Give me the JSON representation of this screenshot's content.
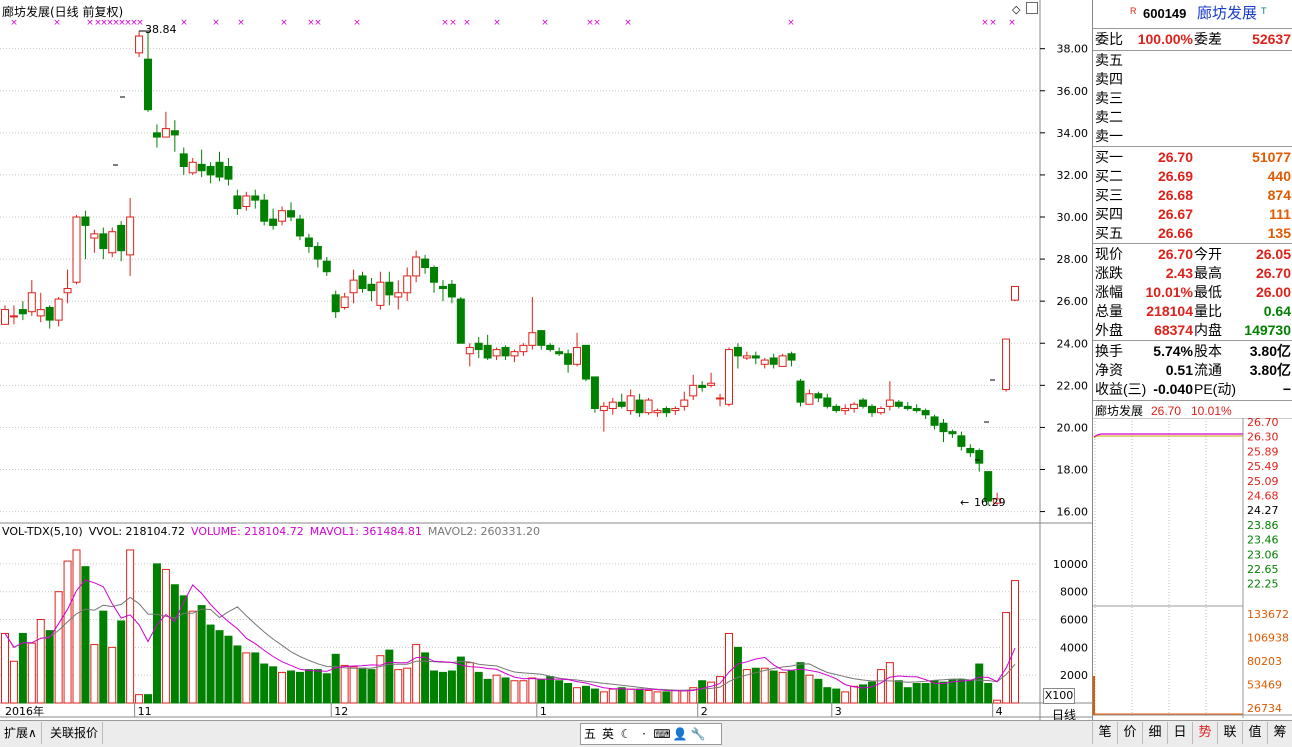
{
  "chart_title": "廊坊发展(日线 前复权)",
  "price_axis": {
    "ticks": [
      "38.00",
      "36.00",
      "34.00",
      "32.00",
      "30.00",
      "28.00",
      "26.00",
      "24.00",
      "22.00",
      "20.00",
      "18.00",
      "16.00"
    ],
    "ylim": [
      15.6,
      39.6
    ]
  },
  "annotations": {
    "high": "38.84",
    "low": "16.29"
  },
  "volume_legend": {
    "indicator": "VOL-TDX(5,10)",
    "vvol": "VVOL: 218104.72",
    "volume": "VOLUME: 218104.72",
    "mavol1": "MAVOL1: 361484.81",
    "mavol2": "MAVOL2: 260331.20"
  },
  "volume_axis": {
    "ticks": [
      "10000",
      "8000",
      "6000",
      "4000",
      "2000"
    ],
    "unit": "X100"
  },
  "x_axis": {
    "labels": [
      "2016年",
      "11",
      "12",
      "1",
      "2",
      "3",
      "4"
    ],
    "period": "日线"
  },
  "colors": {
    "up": "#e0201a",
    "down": "#008000",
    "grid": "#c8c8c8",
    "ma1": "#d400d4",
    "ma2": "#777777"
  },
  "chart_data": {
    "type": "candlestick",
    "title": "廊坊发展(日线 前复权)",
    "ylim": [
      15.6,
      39.6
    ],
    "candles": [
      [
        24.9,
        25.6,
        24.9,
        25.8
      ],
      [
        25.3,
        25.3,
        24.9,
        25.8
      ],
      [
        25.6,
        25.4,
        25.1,
        26.0
      ],
      [
        25.5,
        26.4,
        25.3,
        27.0
      ],
      [
        25.3,
        25.6,
        25.0,
        26.4
      ],
      [
        25.7,
        25.1,
        24.7,
        25.8
      ],
      [
        25.1,
        26.1,
        24.8,
        26.2
      ],
      [
        26.4,
        26.6,
        25.9,
        27.5
      ],
      [
        26.9,
        30.0,
        26.8,
        30.1
      ],
      [
        30.0,
        29.6,
        28.0,
        30.3
      ],
      [
        29.0,
        29.2,
        28.3,
        29.4
      ],
      [
        29.2,
        28.5,
        28.0,
        29.5
      ],
      [
        28.3,
        29.3,
        28.1,
        29.5
      ],
      [
        29.6,
        28.4,
        27.9,
        29.8
      ],
      [
        28.2,
        30.0,
        27.2,
        30.9
      ],
      [
        37.8,
        38.6,
        37.6,
        38.84
      ],
      [
        37.5,
        35.1,
        35.0,
        38.8
      ],
      [
        34.0,
        33.8,
        33.3,
        34.4
      ],
      [
        33.8,
        34.2,
        33.8,
        35.0
      ],
      [
        34.1,
        33.9,
        33.1,
        34.6
      ],
      [
        33.0,
        32.4,
        32.0,
        33.3
      ],
      [
        32.1,
        32.6,
        32.0,
        32.8
      ],
      [
        32.5,
        32.2,
        31.9,
        33.2
      ],
      [
        32.4,
        32.0,
        31.6,
        32.6
      ],
      [
        32.6,
        31.9,
        31.7,
        33.1
      ],
      [
        32.4,
        31.8,
        31.5,
        32.8
      ],
      [
        31.0,
        30.4,
        30.1,
        31.3
      ],
      [
        30.5,
        31.0,
        30.3,
        31.2
      ],
      [
        31.0,
        30.8,
        30.4,
        31.3
      ],
      [
        30.8,
        29.8,
        29.6,
        31.1
      ],
      [
        29.9,
        29.6,
        29.4,
        30.4
      ],
      [
        29.8,
        30.3,
        29.6,
        30.5
      ],
      [
        30.3,
        30.0,
        29.8,
        30.7
      ],
      [
        29.9,
        29.1,
        28.9,
        30.1
      ],
      [
        29.0,
        28.6,
        28.3,
        29.2
      ],
      [
        28.6,
        28.0,
        27.6,
        28.8
      ],
      [
        27.9,
        27.4,
        27.2,
        28.1
      ],
      [
        26.3,
        25.5,
        25.2,
        26.5
      ],
      [
        25.7,
        26.2,
        25.6,
        26.4
      ],
      [
        26.4,
        27.0,
        25.9,
        27.5
      ],
      [
        27.2,
        26.6,
        26.4,
        27.4
      ],
      [
        26.8,
        26.5,
        26.0,
        27.1
      ],
      [
        25.8,
        26.9,
        25.6,
        27.4
      ],
      [
        26.9,
        26.3,
        25.8,
        27.4
      ],
      [
        26.2,
        26.4,
        25.6,
        27.0
      ],
      [
        26.4,
        27.2,
        26.0,
        27.6
      ],
      [
        27.2,
        28.1,
        26.9,
        28.4
      ],
      [
        28.0,
        27.6,
        27.3,
        28.2
      ],
      [
        27.6,
        26.9,
        26.4,
        27.7
      ],
      [
        26.7,
        26.6,
        26.0,
        27.0
      ],
      [
        26.8,
        26.2,
        25.9,
        27.0
      ],
      [
        26.1,
        24.0,
        24.0,
        26.2
      ],
      [
        23.5,
        23.8,
        22.9,
        24.0
      ],
      [
        24.0,
        23.7,
        23.3,
        24.3
      ],
      [
        23.9,
        23.3,
        23.2,
        24.4
      ],
      [
        23.4,
        23.7,
        23.2,
        23.8
      ],
      [
        23.8,
        23.4,
        23.2,
        23.9
      ],
      [
        23.4,
        23.6,
        23.1,
        23.7
      ],
      [
        23.6,
        23.9,
        23.4,
        24.0
      ],
      [
        23.9,
        24.5,
        23.7,
        26.2
      ],
      [
        24.6,
        23.9,
        23.7,
        24.6
      ],
      [
        23.9,
        23.7,
        23.6,
        24.0
      ],
      [
        23.6,
        23.5,
        23.4,
        23.8
      ],
      [
        23.5,
        23.0,
        22.6,
        23.7
      ],
      [
        23.0,
        23.8,
        22.9,
        24.5
      ],
      [
        23.9,
        22.3,
        22.2,
        23.9
      ],
      [
        22.4,
        20.9,
        20.7,
        22.4
      ],
      [
        20.8,
        21.0,
        19.8,
        21.2
      ],
      [
        20.9,
        21.2,
        20.6,
        21.4
      ],
      [
        21.2,
        21.0,
        20.9,
        21.6
      ],
      [
        20.8,
        21.5,
        20.6,
        21.8
      ],
      [
        21.3,
        20.7,
        20.5,
        21.6
      ],
      [
        20.7,
        21.3,
        20.6,
        21.4
      ],
      [
        20.7,
        20.8,
        20.5,
        20.9
      ],
      [
        20.9,
        20.7,
        20.5,
        21.0
      ],
      [
        20.8,
        20.9,
        20.6,
        21.0
      ],
      [
        21.0,
        21.3,
        20.8,
        21.7
      ],
      [
        21.5,
        22.0,
        21.3,
        22.5
      ],
      [
        22.0,
        21.9,
        21.7,
        22.2
      ],
      [
        22.0,
        22.1,
        21.9,
        22.6
      ],
      [
        21.4,
        21.4,
        21.0,
        21.6
      ],
      [
        21.1,
        23.7,
        21.0,
        23.8
      ],
      [
        23.8,
        23.4,
        22.8,
        24.0
      ],
      [
        23.3,
        23.4,
        23.2,
        23.6
      ],
      [
        23.4,
        23.3,
        23.0,
        23.6
      ],
      [
        23.0,
        23.2,
        22.8,
        23.3
      ],
      [
        23.3,
        23.0,
        22.8,
        23.5
      ],
      [
        22.9,
        23.4,
        22.9,
        23.5
      ],
      [
        23.5,
        23.2,
        22.9,
        23.6
      ],
      [
        22.2,
        21.2,
        21.0,
        22.3
      ],
      [
        21.1,
        21.6,
        21.1,
        21.8
      ],
      [
        21.6,
        21.4,
        21.2,
        21.7
      ],
      [
        21.4,
        21.0,
        20.9,
        21.6
      ],
      [
        21.0,
        20.8,
        20.7,
        21.1
      ],
      [
        20.8,
        20.9,
        20.6,
        21.1
      ],
      [
        20.9,
        21.1,
        20.7,
        21.2
      ],
      [
        21.3,
        21.0,
        20.9,
        21.4
      ],
      [
        21.0,
        20.7,
        20.5,
        21.1
      ],
      [
        20.7,
        20.9,
        20.6,
        21.0
      ],
      [
        21.0,
        21.3,
        20.8,
        22.2
      ],
      [
        21.2,
        21.0,
        20.9,
        21.3
      ],
      [
        21.0,
        20.9,
        20.8,
        21.2
      ],
      [
        20.9,
        20.8,
        20.7,
        21.1
      ],
      [
        20.8,
        20.6,
        20.4,
        20.9
      ],
      [
        20.5,
        20.1,
        19.9,
        20.6
      ],
      [
        20.2,
        19.8,
        19.3,
        20.4
      ],
      [
        19.8,
        19.7,
        19.5,
        19.9
      ],
      [
        19.6,
        19.1,
        18.9,
        19.8
      ],
      [
        19.0,
        18.8,
        18.6,
        19.2
      ],
      [
        18.9,
        18.3,
        17.9,
        19.0
      ],
      [
        17.9,
        16.5,
        16.29,
        17.9
      ],
      [
        16.4,
        16.6,
        16.3,
        16.9
      ],
      [
        21.8,
        24.2,
        21.7,
        24.2
      ],
      [
        26.05,
        26.7,
        26.0,
        26.7
      ]
    ],
    "volumes": [
      5000,
      3000,
      5000,
      4300,
      6000,
      5200,
      8000,
      10200,
      11000,
      9800,
      4200,
      6600,
      4000,
      5900,
      11000,
      600,
      600,
      10000,
      9600,
      8500,
      7700,
      6600,
      7000,
      5600,
      5200,
      4800,
      4100,
      3600,
      3600,
      2800,
      2600,
      2200,
      2300,
      2200,
      2400,
      2400,
      2100,
      3500,
      2700,
      2600,
      2500,
      2400,
      3400,
      3800,
      2400,
      2500,
      4200,
      3600,
      2300,
      2200,
      2300,
      3300,
      2900,
      2200,
      1700,
      2000,
      1800,
      1600,
      1600,
      1800,
      1700,
      1900,
      1600,
      1400,
      1100,
      1200,
      1000,
      800,
      1000,
      1100,
      1000,
      1000,
      900,
      800,
      800,
      900,
      900,
      1100,
      1600,
      1500,
      1900,
      5000,
      4000,
      2400,
      2500,
      2500,
      2300,
      2200,
      2300,
      2900,
      2000,
      1700,
      1100,
      1000,
      800,
      1200,
      1300,
      1500,
      2400,
      2900,
      1600,
      1100,
      1400,
      1400,
      1600,
      1500,
      1700,
      1700,
      1600,
      2800,
      1400,
      200,
      6500,
      8800
    ]
  },
  "quote": {
    "flag": "R",
    "code": "600149",
    "name": "廊坊发展",
    "t_flag": "T",
    "weibi_label": "委比",
    "weibi": "100.00%",
    "weicha_label": "委差",
    "weicha": "52637",
    "sells": [
      {
        "label": "卖五",
        "price": "",
        "vol": ""
      },
      {
        "label": "卖四",
        "price": "",
        "vol": ""
      },
      {
        "label": "卖三",
        "price": "",
        "vol": ""
      },
      {
        "label": "卖二",
        "price": "",
        "vol": ""
      },
      {
        "label": "卖一",
        "price": "",
        "vol": ""
      }
    ],
    "buys": [
      {
        "label": "买一",
        "price": "26.70",
        "vol": "51077"
      },
      {
        "label": "买二",
        "price": "26.69",
        "vol": "440"
      },
      {
        "label": "买三",
        "price": "26.68",
        "vol": "874"
      },
      {
        "label": "买四",
        "price": "26.67",
        "vol": "111"
      },
      {
        "label": "买五",
        "price": "26.66",
        "vol": "135"
      }
    ],
    "stats": [
      {
        "l1": "现价",
        "v1": "26.70",
        "c1": "red",
        "l2": "今开",
        "v2": "26.05",
        "c2": "red"
      },
      {
        "l1": "涨跌",
        "v1": "2.43",
        "c1": "red",
        "l2": "最高",
        "v2": "26.70",
        "c2": "red"
      },
      {
        "l1": "涨幅",
        "v1": "10.01%",
        "c1": "red",
        "l2": "最低",
        "v2": "26.00",
        "c2": "red"
      },
      {
        "l1": "总量",
        "v1": "218104",
        "c1": "red",
        "l2": "量比",
        "v2": "0.64",
        "c2": "green"
      },
      {
        "l1": "外盘",
        "v1": "68374",
        "c1": "red",
        "l2": "内盘",
        "v2": "149730",
        "c2": "green"
      }
    ],
    "stats2": [
      {
        "l1": "换手",
        "v1": "5.74%",
        "l2": "股本",
        "v2": "3.80亿"
      },
      {
        "l1": "净资",
        "v1": "0.51",
        "l2": "流通",
        "v2": "3.80亿"
      },
      {
        "l1": "收益(三)",
        "v1": "-0.040",
        "l2": "PE(动)",
        "v2": "−"
      }
    ]
  },
  "intraday": {
    "name": "廊坊发展",
    "price": "26.70",
    "pct": "10.01%",
    "price_ticks": [
      "26.70",
      "26.30",
      "25.89",
      "25.49",
      "25.09",
      "24.68",
      "24.27",
      "23.86",
      "23.46",
      "23.06",
      "22.65",
      "22.25"
    ],
    "vol_ticks": [
      "133672",
      "106938",
      "80203",
      "53469",
      "26734"
    ]
  },
  "bottom_tabs": [
    "扩展∧",
    "关联报价"
  ],
  "ime": [
    "五",
    "英",
    "☾",
    "·",
    "⌨",
    "👤",
    "🔧"
  ],
  "right_tabs": [
    "笔",
    "价",
    "细",
    "日",
    "势",
    "联",
    "值",
    "筹"
  ]
}
